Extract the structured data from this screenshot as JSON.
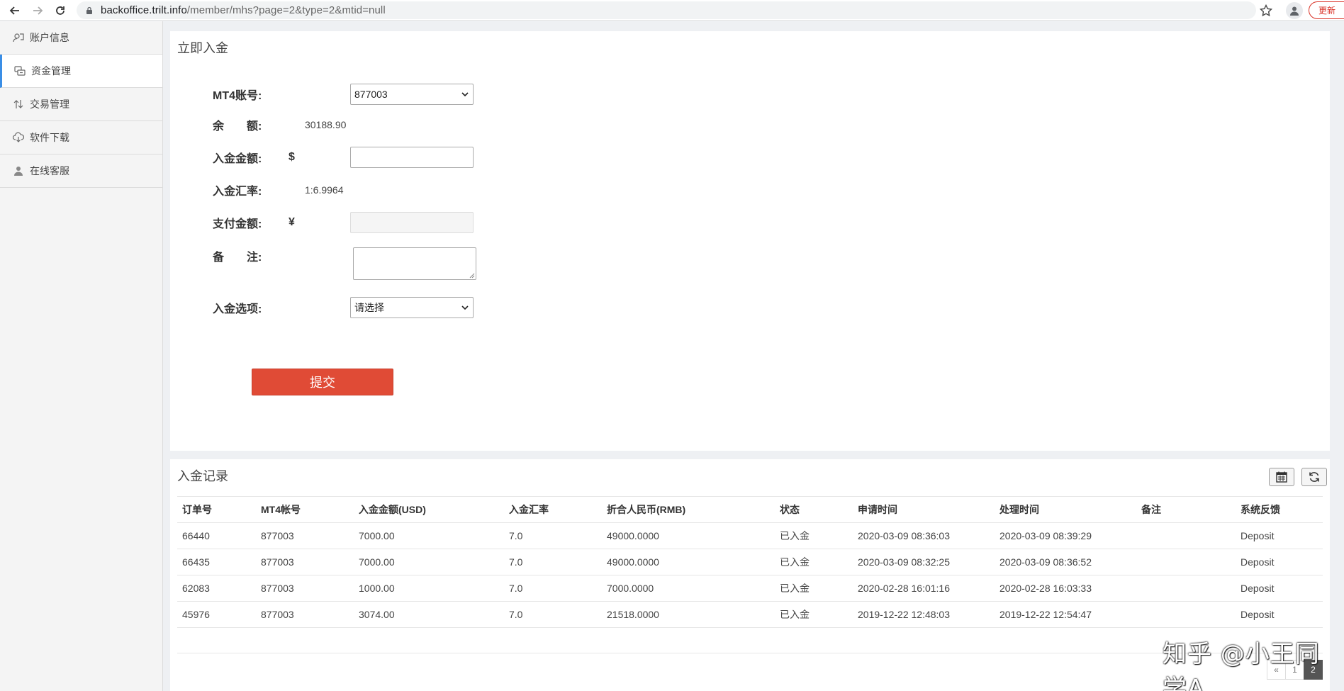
{
  "browser": {
    "url_host": "backoffice.trilt.info",
    "url_path": "/member/mhs?page=2&type=2&mtid=null",
    "update_label": "更新"
  },
  "sidebar": {
    "items": [
      {
        "label": "账户信息",
        "icon": "user-card-icon"
      },
      {
        "label": "资金管理",
        "icon": "coins-icon",
        "active": true
      },
      {
        "label": "交易管理",
        "icon": "exchange-icon"
      },
      {
        "label": "软件下载",
        "icon": "cloud-download-icon"
      },
      {
        "label": "在线客服",
        "icon": "person-icon"
      }
    ]
  },
  "deposit_form": {
    "title": "立即入金",
    "mt4_label": "MT4账号:",
    "mt4_value": "877003",
    "balance_label": "余　　额:",
    "balance_value": "30188.90",
    "amount_label": "入金金额:",
    "amount_currency": "$",
    "amount_value": "",
    "rate_label": "入金汇率:",
    "rate_value": "1:6.9964",
    "pay_label": "支付金额:",
    "pay_currency": "¥",
    "pay_value": "",
    "remark_label": "备　　注:",
    "option_label": "入金选项:",
    "option_value": "请选择",
    "submit_label": "提交"
  },
  "records": {
    "title": "入金记录",
    "columns": [
      "订单号",
      "MT4帐号",
      "入金金额(USD)",
      "入金汇率",
      "折合人民币(RMB)",
      "状态",
      "申请时间",
      "处理时间",
      "备注",
      "系统反馈"
    ],
    "rows": [
      [
        "66440",
        "877003",
        "7000.00",
        "7.0",
        "49000.0000",
        "已入金",
        "2020-03-09 08:36:03",
        "2020-03-09 08:39:29",
        "",
        "Deposit"
      ],
      [
        "66435",
        "877003",
        "7000.00",
        "7.0",
        "49000.0000",
        "已入金",
        "2020-03-09 08:32:25",
        "2020-03-09 08:36:52",
        "",
        "Deposit"
      ],
      [
        "62083",
        "877003",
        "1000.00",
        "7.0",
        "7000.0000",
        "已入金",
        "2020-02-28 16:01:16",
        "2020-02-28 16:03:33",
        "",
        "Deposit"
      ],
      [
        "45976",
        "877003",
        "3074.00",
        "7.0",
        "21518.0000",
        "已入金",
        "2019-12-22 12:48:03",
        "2019-12-22 12:54:47",
        "",
        "Deposit"
      ]
    ],
    "pagination": {
      "prev": "«",
      "pages": [
        "1",
        "2"
      ],
      "current": "2"
    }
  },
  "watermark": "知乎 @小王同学A",
  "colors": {
    "accent": "#3a8ee6",
    "submit": "#e04b36"
  }
}
